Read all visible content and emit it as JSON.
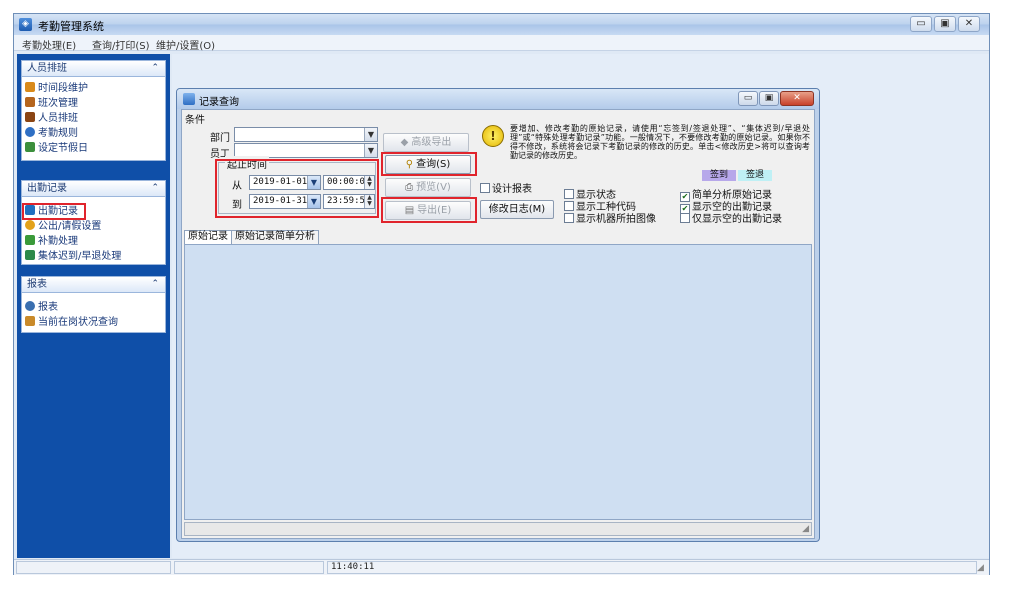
{
  "app": {
    "title": "考勤管理系统"
  },
  "menu": {
    "items": [
      "考勤处理(E)",
      "查询/打印(S)",
      "维护/设置(O)"
    ]
  },
  "sidebar": {
    "groups": [
      {
        "title": "人员排班",
        "items": [
          "时间段维护",
          "班次管理",
          "人员排班",
          "考勤规则",
          "设定节假日"
        ]
      },
      {
        "title": "出勤记录",
        "items": [
          "出勤记录",
          "公出/请假设置",
          "补勤处理",
          "集体迟到/早退处理"
        ]
      },
      {
        "title": "报表",
        "items": [
          "报表",
          "当前在岗状况查询"
        ]
      }
    ]
  },
  "dialog": {
    "title": "记录查询",
    "conditions_caption": "条件",
    "dept_label": "部门",
    "dept_value": "",
    "employee_label": "员工",
    "employee_value": "",
    "time_range_caption": "起止时间",
    "from_label": "从",
    "from_date": "2019-01-01",
    "from_time": "00:00:00",
    "to_label": "到",
    "to_date": "2019-01-31",
    "to_time": "23:59:59",
    "advanced_export_button": "高级导出",
    "query_button": "查询(S)",
    "preview_button": "预览(V)",
    "export_button": "导出(E)",
    "design_report_label": "设计报表",
    "modify_log_button": "修改日志(M)",
    "info_text": "要增加、修改考勤的原始记录，请使用“忘签到/签退处理”、“集体迟到/早退处理”或“特殊处理考勤记录”功能。一般情况下，不要修改考勤的原始记录。如果你不得不修改，系统将会记录下考勤记录的修改的历史。单击<修改历史>将可以查询考勤记录的修改历史。",
    "signin_badge": "签到",
    "signout_badge": "签退",
    "show_status_label": "显示状态",
    "show_work_code_label": "显示工种代码",
    "show_machine_photo_label": "显示机器所拍图像",
    "simple_analysis_label": "简单分析原始记录",
    "show_empty_records_label": "显示空的出勤记录",
    "only_empty_records_label": "仅显示空的出勤记录",
    "simple_analysis_checked": true,
    "show_empty_checked": true,
    "tabs": [
      "原始记录",
      "原始记录简单分析"
    ]
  },
  "statusbar": {
    "time": "11:40:11"
  },
  "colors": {
    "highlight_box": "#e0242c",
    "sidebar_bg": "#0f4fa8",
    "signin_badge": "#b7a8ea",
    "signout_badge": "#bff0f5"
  }
}
